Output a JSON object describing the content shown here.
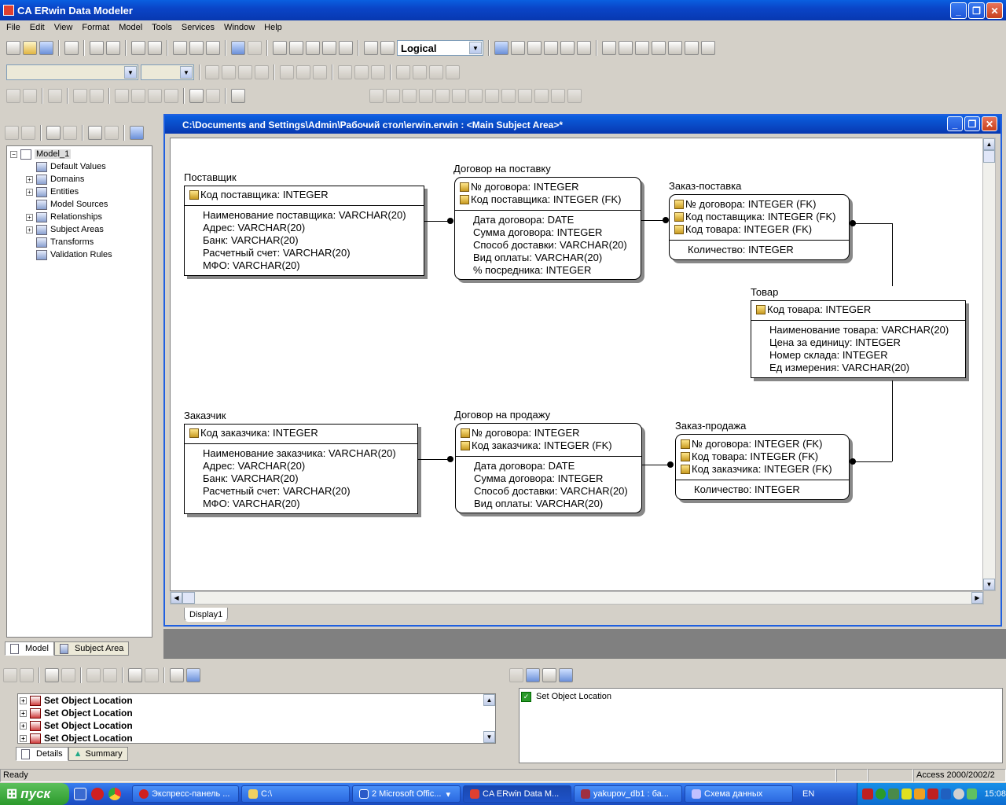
{
  "app": {
    "title": "CA ERwin Data Modeler"
  },
  "menu": [
    "File",
    "Edit",
    "View",
    "Format",
    "Model",
    "Tools",
    "Services",
    "Window",
    "Help"
  ],
  "toolbar": {
    "view_mode": "Logical"
  },
  "model_tree": {
    "root": "Model_1",
    "items": [
      "Default Values",
      "Domains",
      "Entities",
      "Model Sources",
      "Relationships",
      "Subject Areas",
      "Transforms",
      "Validation Rules"
    ]
  },
  "left_tabs": [
    "Model",
    "Subject Area"
  ],
  "doc": {
    "title": "C:\\Documents and Settings\\Admin\\Рабочий стол\\erwin.erwin : <Main Subject Area>*",
    "tab": "Display1"
  },
  "entities": {
    "supplier": {
      "name": "Поставщик",
      "keys": [
        "Код поставщика: INTEGER"
      ],
      "attrs": [
        "Наименование поставщика: VARCHAR(20)",
        "Адрес: VARCHAR(20)",
        "Банк: VARCHAR(20)",
        "Расчетный счет: VARCHAR(20)",
        "МФО: VARCHAR(20)"
      ]
    },
    "supply_contract": {
      "name": "Договор на поставку",
      "keys": [
        "№ договора: INTEGER",
        "Код поставщика: INTEGER (FK)"
      ],
      "attrs": [
        "Дата договора: DATE",
        "Сумма договора: INTEGER",
        "Способ доставки: VARCHAR(20)",
        "Вид оплаты: VARCHAR(20)",
        "% посредника: INTEGER"
      ]
    },
    "supply_order": {
      "name": "Заказ-поставка",
      "keys": [
        "№ договора: INTEGER (FK)",
        "Код поставщика: INTEGER (FK)",
        "Код товара: INTEGER (FK)"
      ],
      "attrs": [
        "Количество: INTEGER"
      ]
    },
    "product": {
      "name": "Товар",
      "keys": [
        "Код товара: INTEGER"
      ],
      "attrs": [
        "Наименование товара: VARCHAR(20)",
        "Цена за единицу: INTEGER",
        "Номер склада: INTEGER",
        "Ед измерения: VARCHAR(20)"
      ]
    },
    "customer": {
      "name": "Заказчик",
      "keys": [
        "Код заказчика: INTEGER"
      ],
      "attrs": [
        "Наименование заказчика: VARCHAR(20)",
        "Адрес: VARCHAR(20)",
        "Банк: VARCHAR(20)",
        "Расчетный счет: VARCHAR(20)",
        "МФО: VARCHAR(20)"
      ]
    },
    "sale_contract": {
      "name": "Договор на продажу",
      "keys": [
        "№ договора: INTEGER",
        "Код заказчика: INTEGER (FK)"
      ],
      "attrs": [
        "Дата договора: DATE",
        "Сумма договора: INTEGER",
        "Способ доставки: VARCHAR(20)",
        "Вид оплаты: VARCHAR(20)"
      ]
    },
    "sale_order": {
      "name": "Заказ-продажа",
      "keys": [
        "№ договора: INTEGER (FK)",
        "Код товара: INTEGER (FK)",
        "Код заказчика: INTEGER (FK)"
      ],
      "attrs": [
        "Количество: INTEGER"
      ]
    }
  },
  "action_log": {
    "items": [
      "Set Object Location",
      "Set Object Location",
      "Set Object Location",
      "Set Object Location"
    ],
    "tabs": [
      "Details",
      "Summary"
    ]
  },
  "right_log": {
    "items": [
      "Set Object Location"
    ]
  },
  "status": {
    "left": "Ready",
    "right": "Access 2000/2002/2"
  },
  "taskbar": {
    "start": "пуск",
    "buttons": [
      "Экспресс-панель ...",
      "C:\\",
      "2 Microsoft Offic...",
      "CA ERwin Data M...",
      "yakupov_db1 : ба...",
      "Схема данных"
    ],
    "lang": "EN",
    "clock": "15:08"
  }
}
